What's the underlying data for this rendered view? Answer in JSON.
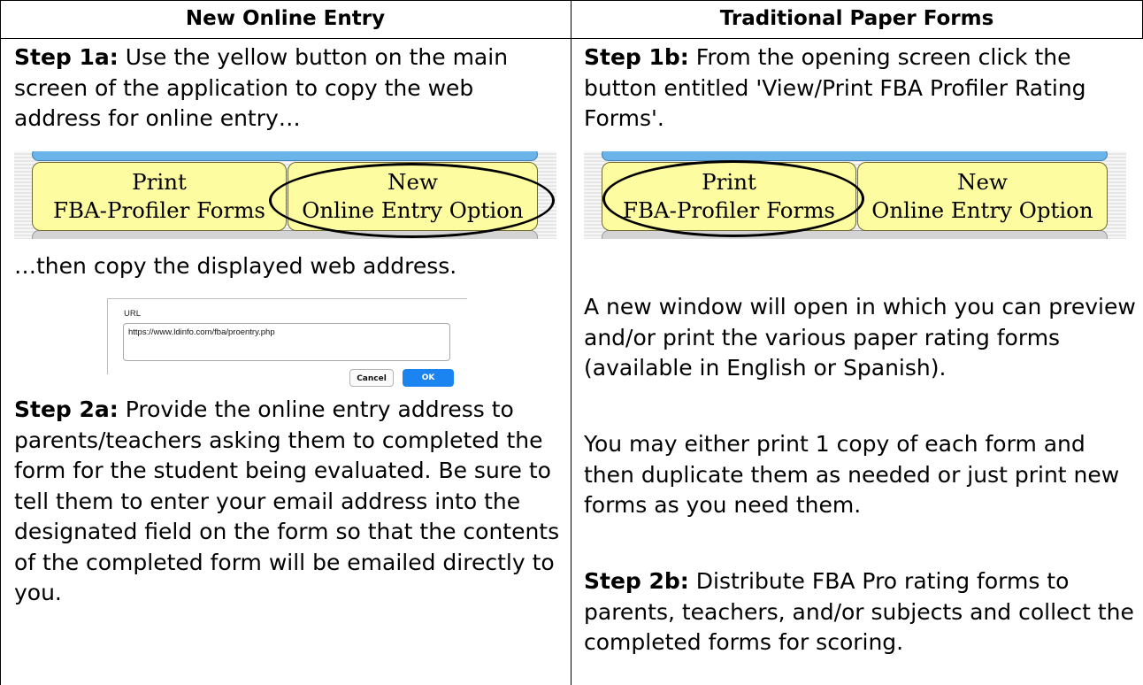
{
  "headers": {
    "left": "New Online Entry",
    "right": "Traditional Paper Forms"
  },
  "left": {
    "step1a_label": "Step 1a:",
    "step1a_text": " Use the yellow button on the main screen of the application to copy the web address for online entry…",
    "then_text": "…then copy the displayed web address.",
    "step2a_label": "Step 2a:",
    "step2a_text": "  Provide the online entry address to parents/teachers asking them to completed the form for the student being evaluated. Be sure to tell them to enter your email address into the designated field on the form so that the contents of the completed form will be emailed directly to you."
  },
  "right": {
    "step1b_label": "Step 1b:",
    "step1b_text": " From the opening screen click the button entitled 'View/Print FBA Profiler Rating Forms'.",
    "para1": "A new window will open in which you can preview and/or print the various paper rating forms (available in English or Spanish).",
    "para2": "You may either print 1 copy of each form and then duplicate them as needed or just print new forms as you need them.",
    "step2b_label": "Step 2b:",
    "step2b_text": " Distribute FBA Pro rating forms to parents, teachers, and/or subjects and collect the completed forms for scoring."
  },
  "app_buttons": {
    "print_line1": "Print",
    "print_line2": "FBA-Profiler Forms",
    "new_line1": "New",
    "new_line2": "Online Entry Option"
  },
  "url_dialog": {
    "label": "URL",
    "value": "https://www.ldinfo.com/fba/proentry.php",
    "cancel": "Cancel",
    "ok": "OK"
  }
}
